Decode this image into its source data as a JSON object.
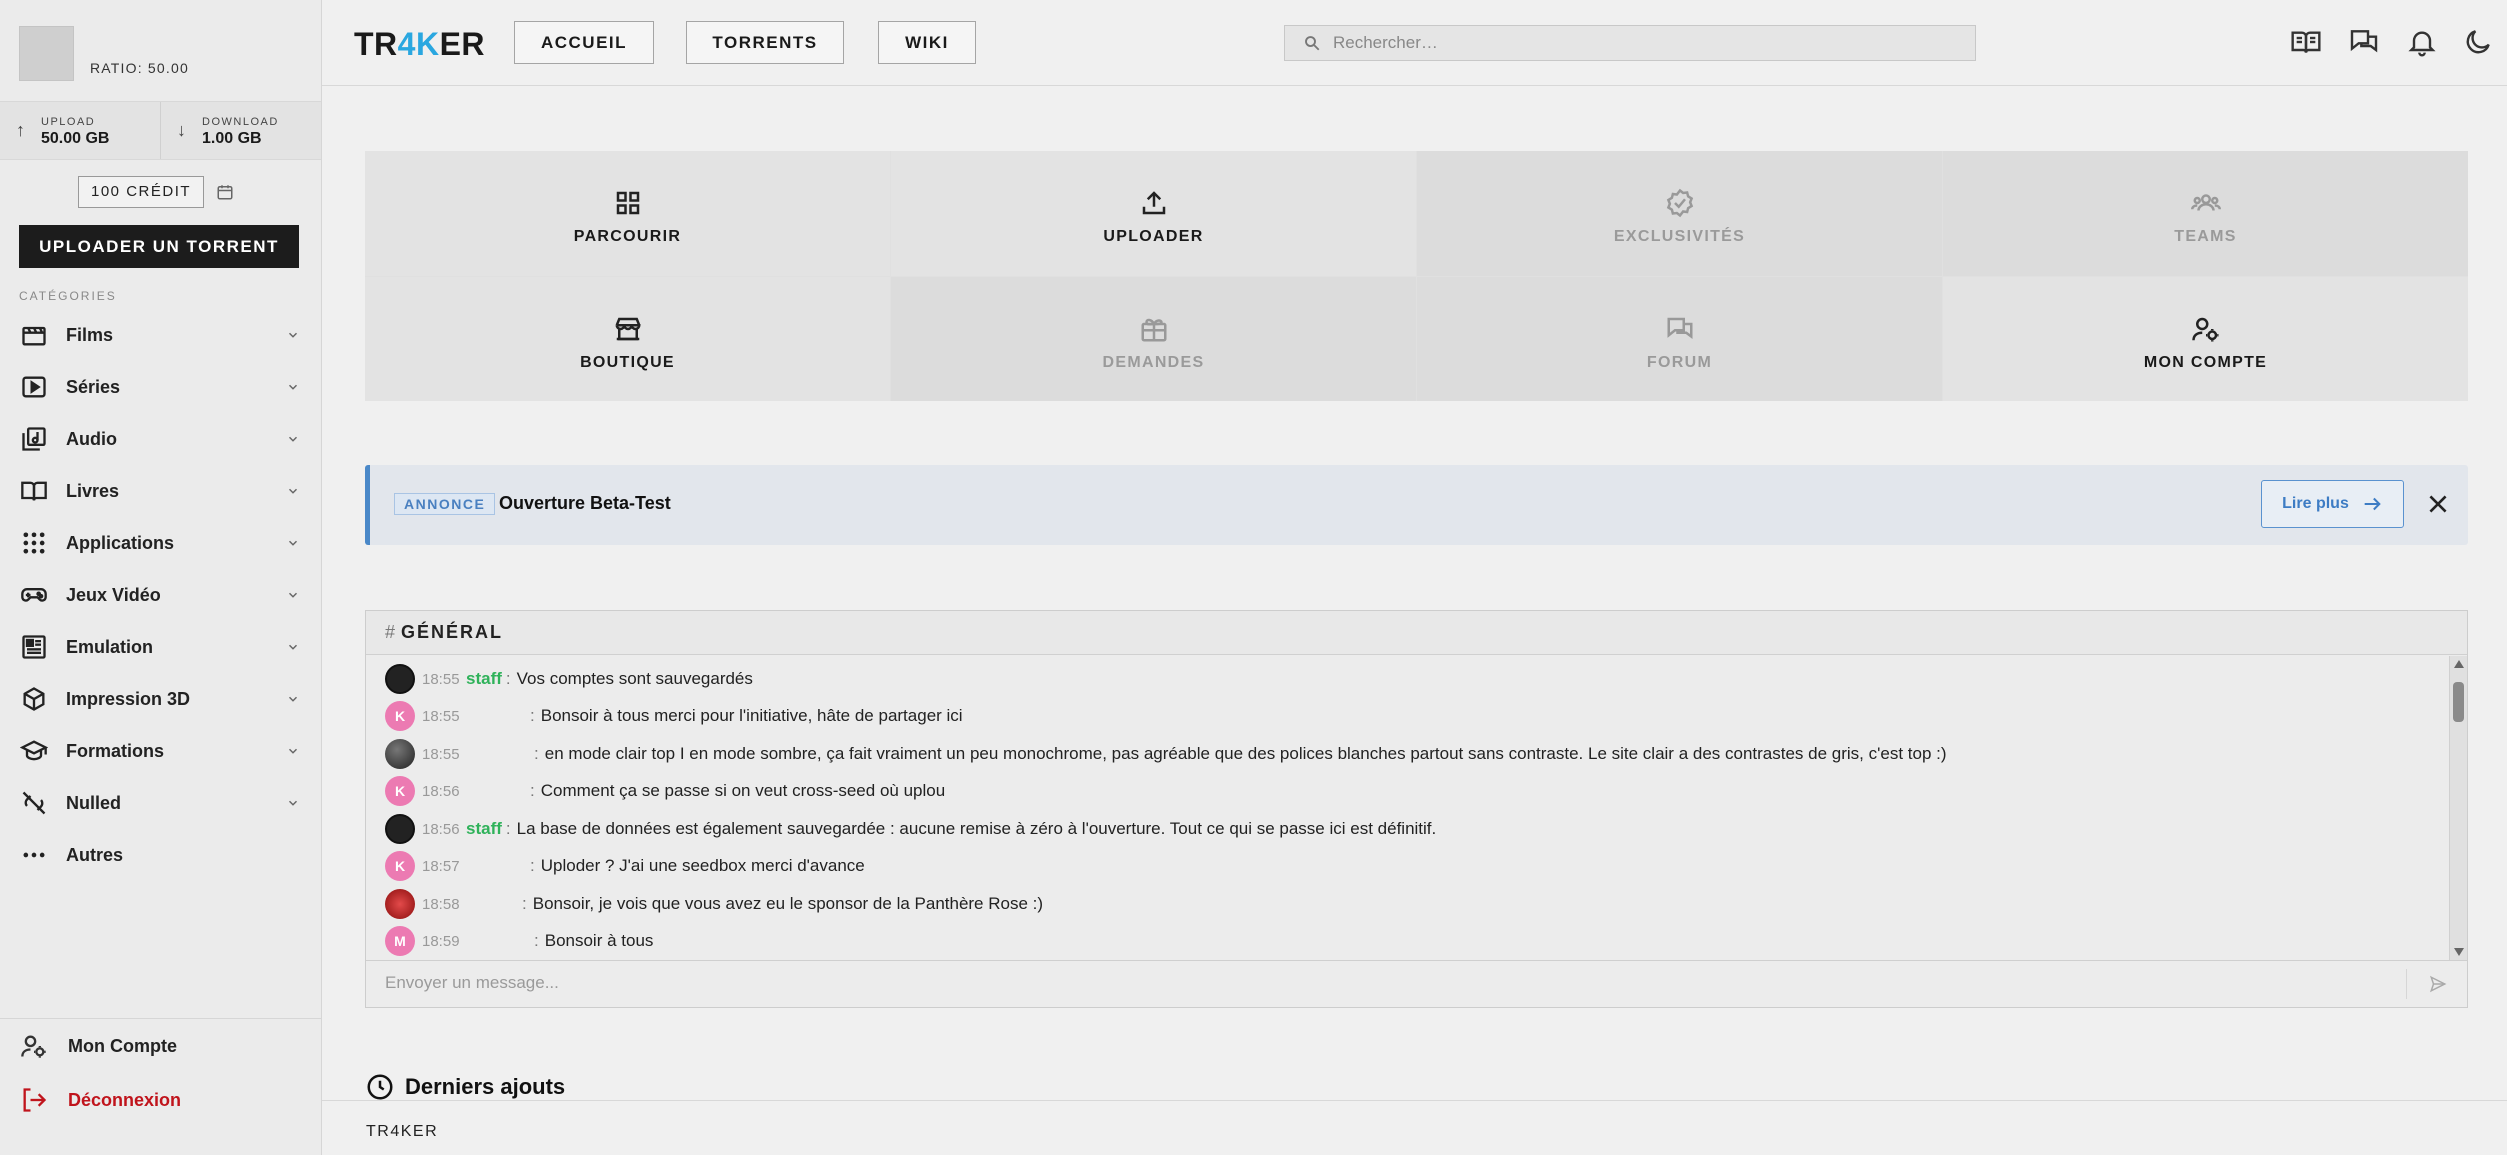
{
  "user": {
    "ratio": "RATIO: 50.00"
  },
  "stats": {
    "upload_label": "UPLOAD",
    "upload_value": "50.00 GB",
    "download_label": "DOWNLOAD",
    "download_value": "1.00 GB"
  },
  "credit": "100 CRÉDIT",
  "upload_button": "UPLOADER UN TORRENT",
  "categories_title": "CATÉGORIES",
  "categories": [
    {
      "label": "Films",
      "icon": "film-icon"
    },
    {
      "label": "Séries",
      "icon": "play-icon"
    },
    {
      "label": "Audio",
      "icon": "music-icon"
    },
    {
      "label": "Livres",
      "icon": "book-icon"
    },
    {
      "label": "Applications",
      "icon": "grid-dots-icon"
    },
    {
      "label": "Jeux Vidéo",
      "icon": "gamepad-icon"
    },
    {
      "label": "Emulation",
      "icon": "emulation-icon"
    },
    {
      "label": "Impression 3D",
      "icon": "cube-icon"
    },
    {
      "label": "Formations",
      "icon": "graduation-cap-icon"
    },
    {
      "label": "Nulled",
      "icon": "nulled-icon"
    },
    {
      "label": "Autres",
      "icon": "more-dots-icon"
    }
  ],
  "sidebar_bottom": {
    "account": "Mon Compte",
    "logout": "Déconnexion"
  },
  "header": {
    "logo_a": "TR",
    "logo_b": "4K",
    "logo_c": "ER",
    "nav": [
      "ACCUEIL",
      "TORRENTS",
      "WIKI"
    ],
    "search_placeholder": "Rechercher…"
  },
  "tiles": [
    {
      "label": "PARCOURIR",
      "icon": "grid-icon",
      "dim": false
    },
    {
      "label": "UPLOADER",
      "icon": "upload-icon",
      "dim": false
    },
    {
      "label": "EXCLUSIVITÉS",
      "icon": "badge-check-icon",
      "dim": true
    },
    {
      "label": "TEAMS",
      "icon": "users-icon",
      "dim": true
    },
    {
      "label": "BOUTIQUE",
      "icon": "store-icon",
      "dim": false
    },
    {
      "label": "DEMANDES",
      "icon": "gift-icon",
      "dim": true
    },
    {
      "label": "FORUM",
      "icon": "forum-icon",
      "dim": true
    },
    {
      "label": "MON COMPTE",
      "icon": "user-gear-icon",
      "dim": false
    }
  ],
  "announcement": {
    "tag": "ANNONCE",
    "title": "Ouverture Beta-Test",
    "more": "Lire plus"
  },
  "chat": {
    "hash": "#",
    "title": "GÉNÉRAL",
    "messages": [
      {
        "avatar": "dark",
        "initial": "",
        "time": "18:55",
        "user": "staff",
        "text": "Vos comptes sont sauvegardés"
      },
      {
        "avatar": "pink",
        "initial": "K",
        "time": "18:55",
        "user": "",
        "text": "Bonsoir à tous merci pour l'initiative, hâte de partager ici"
      },
      {
        "avatar": "photo",
        "initial": "",
        "time": "18:55",
        "user": "",
        "text": "en mode clair top I en mode sombre, ça fait vraiment un peu monochrome, pas agréable que des polices blanches partout sans contraste. Le site clair a des contrastes de gris, c'est top :)"
      },
      {
        "avatar": "pink",
        "initial": "K",
        "time": "18:56",
        "user": "",
        "text": "Comment ça se passe si on veut cross-seed où uplou"
      },
      {
        "avatar": "dark",
        "initial": "",
        "time": "18:56",
        "user": "staff",
        "text": "La base de données est également sauvegardée : aucune remise à zéro à l'ouverture. Tout ce qui se passe ici est définitif."
      },
      {
        "avatar": "pink",
        "initial": "K",
        "time": "18:57",
        "user": "",
        "text": "Uploder ? J'ai une seedbox merci d'avance"
      },
      {
        "avatar": "red",
        "initial": "",
        "time": "18:58",
        "user": "",
        "text": "Bonsoir, je vois que vous avez eu le sponsor de la Panthère Rose :)"
      },
      {
        "avatar": "pink",
        "initial": "M",
        "time": "18:59",
        "user": "",
        "text": "Bonsoir à tous"
      }
    ],
    "input_placeholder": "Envoyer un message..."
  },
  "latest_title": "Derniers ajouts",
  "footer": "TR4KER"
}
